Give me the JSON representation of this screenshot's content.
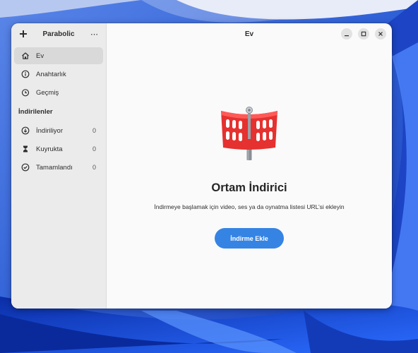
{
  "window": {
    "app_title": "Parabolic",
    "page_title": "Ev"
  },
  "sidebar": {
    "add_icon": "plus-icon",
    "menu_glyph": "⋯",
    "items": [
      {
        "label": "Ev",
        "icon": "home-icon",
        "active": true
      },
      {
        "label": "Anahtarlık",
        "icon": "info-icon"
      },
      {
        "label": "Geçmiş",
        "icon": "history-icon"
      }
    ],
    "downloads_section": {
      "label": "İndirilenler",
      "items": [
        {
          "label": "İndiriliyor",
          "icon": "download-icon",
          "count": "0"
        },
        {
          "label": "Kuyrukta",
          "icon": "hourglass-icon",
          "count": "0"
        },
        {
          "label": "Tamamlandı",
          "icon": "check-circle-icon",
          "count": "0"
        }
      ]
    }
  },
  "main": {
    "title": "Ortam İndirici",
    "subtitle": "İndirmeye başlamak için video, ses ya da oynatma listesi URL’si ekleyin",
    "button_label": "İndirme Ekle",
    "accent_color": "#3584e4",
    "icon_color": "#e8393b"
  }
}
